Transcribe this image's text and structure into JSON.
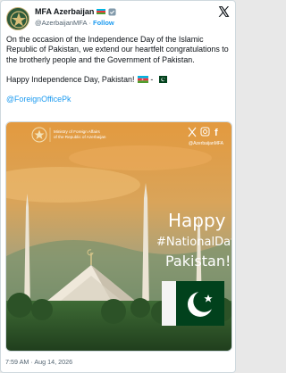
{
  "account": {
    "name": "MFA Azerbaijan",
    "handle": "@AzerbaijanMFA",
    "separator": "·",
    "follow_label": "Follow"
  },
  "tweet": {
    "paragraph1": "On the occasion of the Independence Day of the Islamic Republic of Pakistan, we extend our heartfelt congratulations to the brotherly people and the Government of Pakistan.",
    "paragraph2_text": "Happy Independence Day, Pakistan!",
    "paragraph2_sep": "-",
    "mention": "@ForeignOfficePk",
    "timestamp": "7:59 AM · Aug 14, 2026"
  },
  "media": {
    "ministry_line1": "Ministry of Foreign Affairs",
    "ministry_line2": "of the Republic of Azerbaijan",
    "social_handle": "@AzerbaijanMFA",
    "greeting_line1": "Happy",
    "greeting_line2": "#NationalDay",
    "greeting_line3": "Pakistan!"
  },
  "colors": {
    "link": "#1d9bf0",
    "az_blue": "#00b5e2",
    "az_red": "#ef3340",
    "az_green": "#509e2f",
    "pk_green": "#01411c"
  },
  "icons": [
    "x-logo-icon",
    "verified-badge-icon",
    "x-social-icon",
    "instagram-icon",
    "facebook-icon",
    "mfa-emblem-icon"
  ]
}
